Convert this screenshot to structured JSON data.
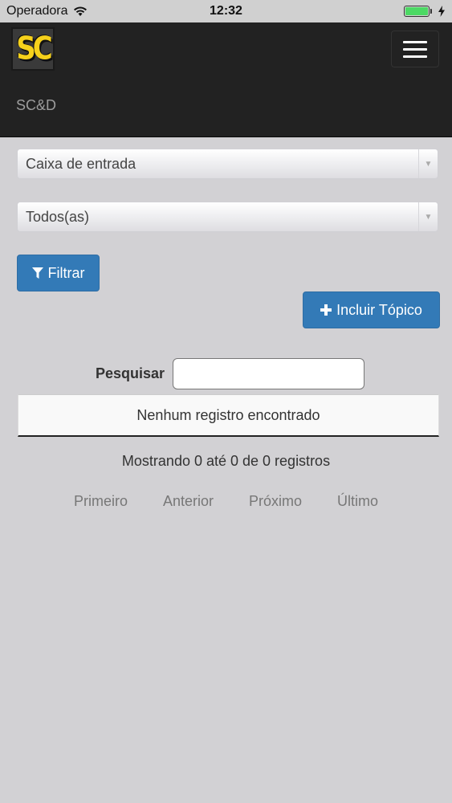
{
  "status_bar": {
    "carrier": "Operadora",
    "time": "12:32"
  },
  "navbar": {
    "logo_text": "SC",
    "brand": "SC&D"
  },
  "filters": {
    "folder_select": "Caixa de entrada",
    "status_select": "Todos(as)",
    "filter_button": "Filtrar"
  },
  "actions": {
    "add_topic_button": "Incluir Tópico"
  },
  "search": {
    "label": "Pesquisar",
    "value": ""
  },
  "table": {
    "empty_message": "Nenhum registro encontrado"
  },
  "info": "Mostrando 0 até 0 de 0 registros",
  "pagination": {
    "first": "Primeiro",
    "previous": "Anterior",
    "next": "Próximo",
    "last": "Último"
  },
  "colors": {
    "primary": "#337ab7",
    "navbar": "#222222",
    "background": "#d2d1d4",
    "logo_yellow": "#f6d11b",
    "battery": "#4cd964"
  },
  "icons": {
    "wifi": "wifi-icon",
    "battery": "battery-icon",
    "charging": "bolt-icon",
    "menu": "hamburger-icon",
    "filter": "funnel-icon",
    "add": "plus-icon",
    "dropdown": "chevron-down-icon"
  }
}
